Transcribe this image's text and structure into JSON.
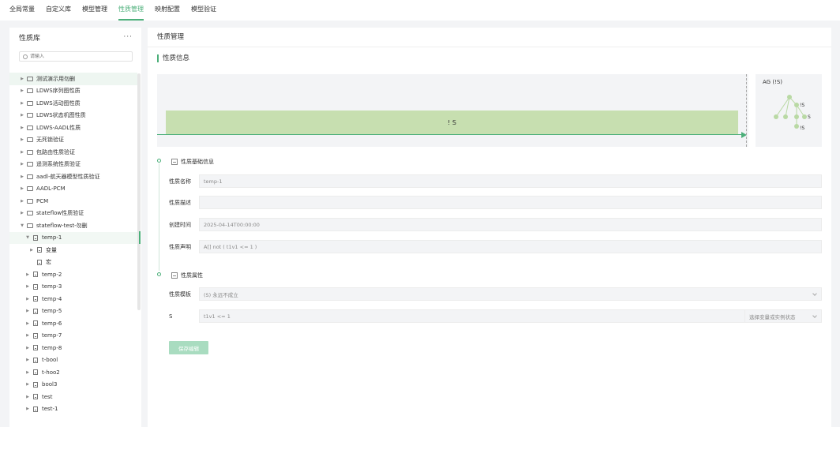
{
  "nav": {
    "tabs": [
      {
        "label": "全局常量"
      },
      {
        "label": "自定义库"
      },
      {
        "label": "模型管理"
      },
      {
        "label": "性质管理"
      },
      {
        "label": "映射配置"
      },
      {
        "label": "模型验证"
      }
    ],
    "active_index": 3
  },
  "sidebar": {
    "title": "性质库",
    "more": "···",
    "search_placeholder": "请输入",
    "items": [
      {
        "label": "测试演示用勿删",
        "type": "folder",
        "depth": 0,
        "expanded": false
      },
      {
        "label": "LDWS序列图性质",
        "type": "folder",
        "depth": 0,
        "expanded": false
      },
      {
        "label": "LDWS活动图性质",
        "type": "folder",
        "depth": 0,
        "expanded": false
      },
      {
        "label": "LDWS状态机图性质",
        "type": "folder",
        "depth": 0,
        "expanded": false
      },
      {
        "label": "LDWS-AADL性质",
        "type": "folder",
        "depth": 0,
        "expanded": false
      },
      {
        "label": "无死锁验证",
        "type": "folder",
        "depth": 0,
        "expanded": false
      },
      {
        "label": "包路由性质验证",
        "type": "folder",
        "depth": 0,
        "expanded": false
      },
      {
        "label": "遥测系统性质验证",
        "type": "folder",
        "depth": 0,
        "expanded": false
      },
      {
        "label": "aadl-航天器模型性质验证",
        "type": "folder",
        "depth": 0,
        "expanded": false
      },
      {
        "label": "AADL-PCM",
        "type": "folder",
        "depth": 0,
        "expanded": false
      },
      {
        "label": "PCM",
        "type": "folder",
        "depth": 0,
        "expanded": false
      },
      {
        "label": "stateflow性质验证",
        "type": "folder",
        "depth": 0,
        "expanded": false
      },
      {
        "label": "stateflow-test-勿删",
        "type": "folder",
        "depth": 0,
        "expanded": true
      },
      {
        "label": "temp-1",
        "type": "file",
        "depth": 1,
        "expanded": true,
        "selected": true
      },
      {
        "label": "变量",
        "type": "file",
        "depth": 2,
        "expanded": false
      },
      {
        "label": "宏",
        "type": "file",
        "depth": 2,
        "leaf": true
      },
      {
        "label": "temp-2",
        "type": "file",
        "depth": 1,
        "expanded": false
      },
      {
        "label": "temp-3",
        "type": "file",
        "depth": 1,
        "expanded": false
      },
      {
        "label": "temp-4",
        "type": "file",
        "depth": 1,
        "expanded": false
      },
      {
        "label": "temp-5",
        "type": "file",
        "depth": 1,
        "expanded": false
      },
      {
        "label": "temp-6",
        "type": "file",
        "depth": 1,
        "expanded": false
      },
      {
        "label": "temp-7",
        "type": "file",
        "depth": 1,
        "expanded": false
      },
      {
        "label": "temp-8",
        "type": "file",
        "depth": 1,
        "expanded": false
      },
      {
        "label": "t-bool",
        "type": "file",
        "depth": 1,
        "expanded": false
      },
      {
        "label": "t-hoo2",
        "type": "file",
        "depth": 1,
        "expanded": false
      },
      {
        "label": "bool3",
        "type": "file",
        "depth": 1,
        "expanded": false
      },
      {
        "label": "test",
        "type": "file",
        "depth": 1,
        "expanded": false
      },
      {
        "label": "test-1",
        "type": "file",
        "depth": 1,
        "expanded": false
      }
    ]
  },
  "main": {
    "header": "性质管理",
    "section_title": "性质信息",
    "timeline_label": "! S",
    "formula_title": "AG (!S)",
    "tree_labels": [
      "!S",
      "S",
      "!S"
    ],
    "basic_group": "性质基础信息",
    "fields": [
      {
        "label": "性质名称",
        "value": "temp-1"
      },
      {
        "label": "性质描述",
        "value": ""
      },
      {
        "label": "创建时间",
        "value": "2025-04-14T00:00:00"
      },
      {
        "label": "性质声明",
        "value": "A[] not ( t1v1 <= 1 )"
      }
    ],
    "attr_group": "性质属性",
    "template_label": "性质模板",
    "template_value": "(S) 永远不成立",
    "s_label": "S",
    "s_value": "t1v1 <= 1",
    "s_select_placeholder": "选择变量或实例状态",
    "save_label": "保存编辑"
  },
  "colors": {
    "accent": "#4caf7a",
    "bar": "#c7dfb0",
    "panel": "#f3f4f6"
  }
}
